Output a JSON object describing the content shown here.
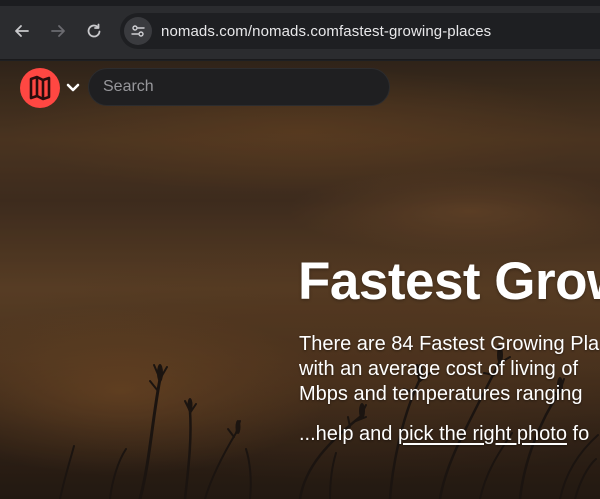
{
  "browser": {
    "url": "nomads.com/nomads.comfastest-growing-places"
  },
  "header": {
    "search_placeholder": "Search"
  },
  "hero": {
    "title": "Fastest Grow",
    "description_lines": [
      "There are 84 Fastest Growing Pla",
      "with an average cost of living of ",
      "Mbps and temperatures ranging"
    ],
    "help_prefix": "...help and ",
    "help_link": "pick the right photo",
    "help_suffix": " fo"
  },
  "colors": {
    "brand": "#ff4742",
    "browser_chrome": "#2b2c2f",
    "search_bg": "#1f1f21"
  }
}
